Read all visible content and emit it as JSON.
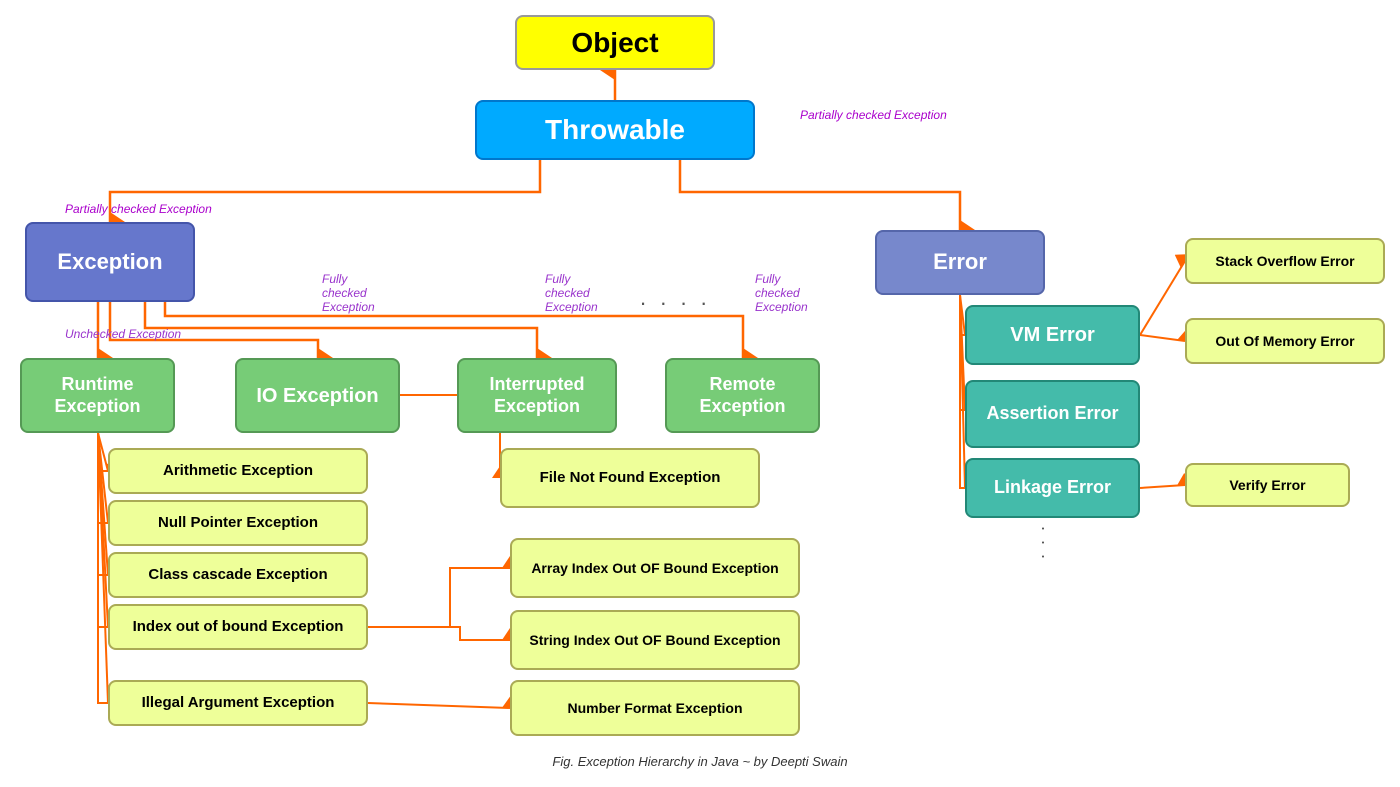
{
  "nodes": {
    "object": "Object",
    "throwable": "Throwable",
    "exception": "Exception",
    "error": "Error",
    "runtime": "Runtime Exception",
    "io": "IO Exception",
    "interrupted": "Interrupted Exception",
    "remote": "Remote Exception",
    "vm": "VM Error",
    "assertion": "Assertion Error",
    "linkage": "Linkage Error",
    "arithmetic": "Arithmetic Exception",
    "null_pointer": "Null Pointer Exception",
    "class_cascade": "Class cascade Exception",
    "index_bound": "Index out of bound Exception",
    "illegal_argument": "Illegal Argument Exception",
    "file_not_found": "File Not Found Exception",
    "array_index": "Array Index Out OF Bound Exception",
    "string_index": "String Index Out OF Bound Exception",
    "number_format": "Number Format Exception",
    "stack_overflow": "Stack Overflow Error",
    "out_of_memory": "Out Of Memory Error",
    "verify_error": "Verify Error"
  },
  "labels": {
    "partially_checked_1": "Partially checked Exception",
    "partially_checked_2": "Partially checked Exception",
    "fully_checked_1": "Fully checked Exception",
    "fully_checked_2": "Fully checked Exception",
    "unchecked": "Unchecked Exception"
  },
  "caption": "Fig. Exception Hierarchy in Java ~ by Deepti Swain",
  "dots_horizontal": ". . . .",
  "dots_vertical_1": ".",
  "dots_vertical_2": ".",
  "dots_vertical_3": "."
}
